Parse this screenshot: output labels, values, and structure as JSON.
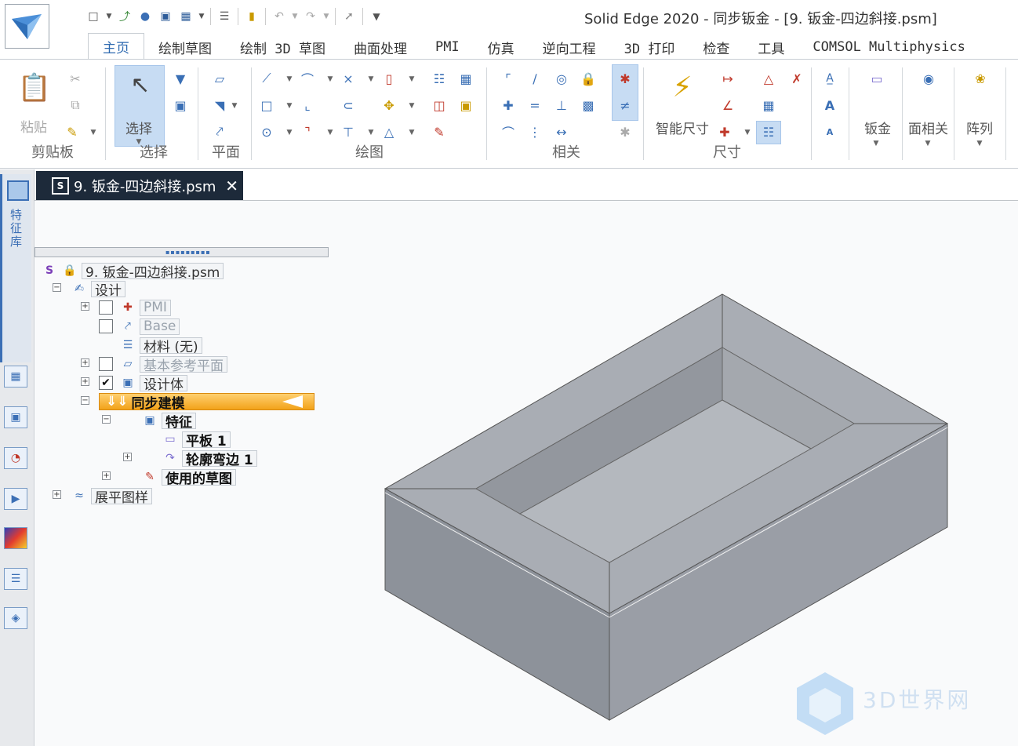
{
  "window": {
    "title": "Solid Edge 2020 - 同步钣金 - [9. 钣金-四边斜接.psm]"
  },
  "quick_access": [
    "new-icon",
    "dropdown",
    "open-icon",
    "rename-icon",
    "save-icon",
    "save-all-icon",
    "dropdown",
    "list-icon",
    "import-icon",
    "undo-icon",
    "dropdown",
    "redo-icon",
    "dropdown",
    "measure-icon",
    "customize-icon"
  ],
  "ribbon": {
    "tabs": [
      "主页",
      "绘制草图",
      "绘制 3D 草图",
      "曲面处理",
      "PMI",
      "仿真",
      "逆向工程",
      "3D 打印",
      "检查",
      "工具",
      "COMSOL Multiphysics"
    ],
    "active_tab": "主页",
    "groups": {
      "clipboard": {
        "label": "剪贴板",
        "paste": "粘贴"
      },
      "select": {
        "label": "选择",
        "button": "选择"
      },
      "plane": {
        "label": "平面"
      },
      "draw": {
        "label": "绘图"
      },
      "relate": {
        "label": "相关"
      },
      "dimension": {
        "label": "尺寸",
        "smart_dim": "智能尺寸"
      },
      "sheetmetal": {
        "label": "钣金"
      },
      "face_relate": {
        "label": "面相关"
      },
      "pattern": {
        "label": "阵列"
      }
    }
  },
  "document_tab": {
    "name": "9. 钣金-四边斜接.psm"
  },
  "left_bar": {
    "library_label": "特征库"
  },
  "tree": {
    "root": "9. 钣金-四边斜接.psm",
    "design": "设计",
    "pmi": "PMI",
    "base": "Base",
    "material": "材料 (无)",
    "ref_planes": "基本参考平面",
    "design_body": "设计体",
    "sync_modeling": "同步建模",
    "features": "特征",
    "tab1": "平板 1",
    "contour_flange": "轮廓弯边 1",
    "used_sketches": "使用的草图",
    "flat_pattern": "展平图样"
  },
  "watermark": {
    "text": "3D世界网"
  },
  "colors": {
    "accent": "#2e6ab0",
    "highlight": "#f2a21a",
    "model_top": "#a9adb4",
    "model_side": "#8d929a",
    "model_front": "#9a9ea6",
    "model_inner": "#b4b8be"
  }
}
